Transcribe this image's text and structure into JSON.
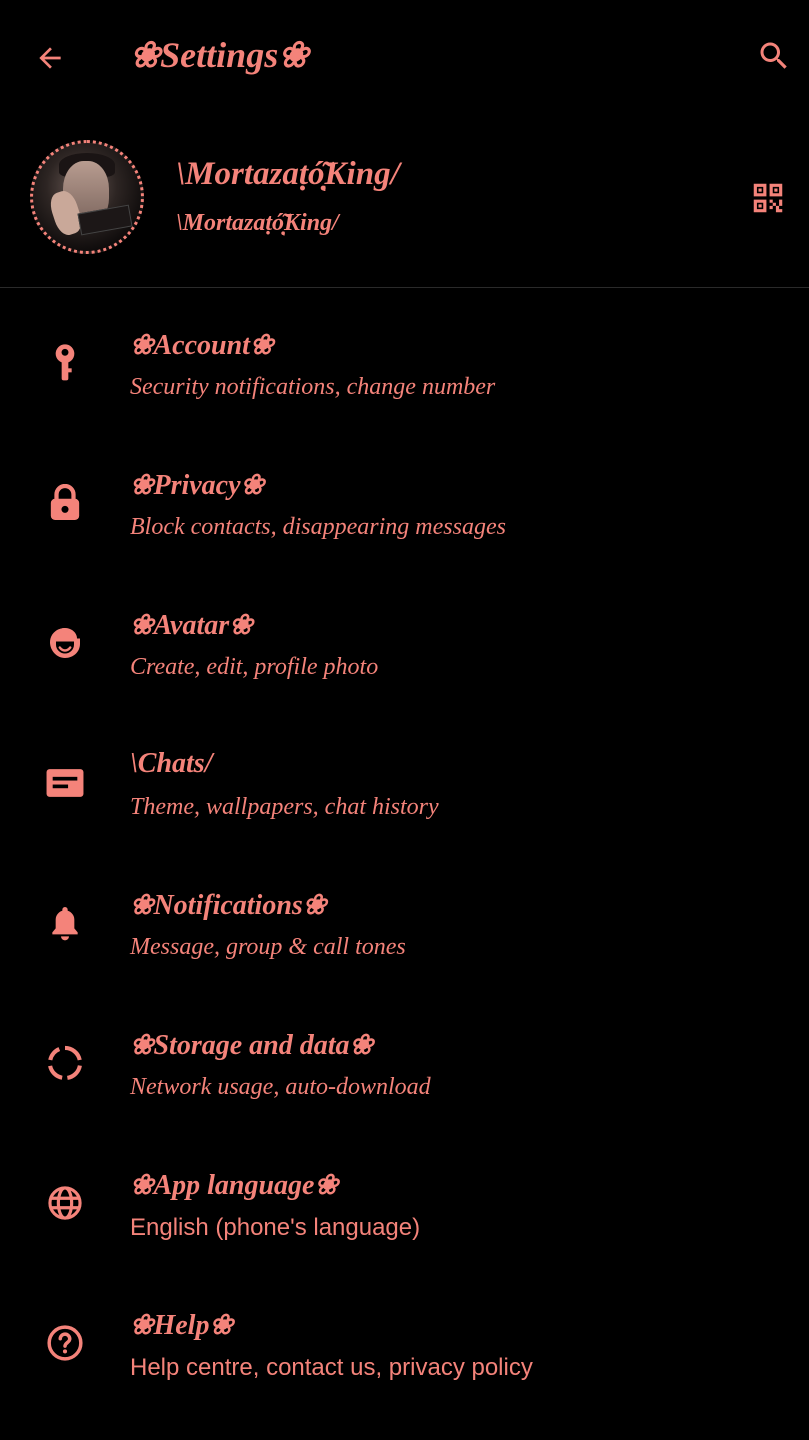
{
  "colors": {
    "background": "#000000",
    "accent": "#f4837a",
    "divider": "#2a2a2a"
  },
  "header": {
    "title": "❀Settings❀",
    "back_icon": "arrow-left-icon",
    "search_icon": "search-icon"
  },
  "profile": {
    "name": "\\Mortazaṭó̩̣͂King/",
    "about": "\\Mortazaṭó̩̣͂King/",
    "qr_icon": "qr-code-icon"
  },
  "menu": {
    "items": [
      {
        "id": "account",
        "icon": "key-icon",
        "title": "❀Account❀",
        "subtitle": "Security notifications, change number",
        "subtitle_style": "italic"
      },
      {
        "id": "privacy",
        "icon": "lock-icon",
        "title": "❀Privacy❀",
        "subtitle": "Block contacts, disappearing messages",
        "subtitle_style": "italic"
      },
      {
        "id": "avatar",
        "icon": "avatar-face-icon",
        "title": "❀Avatar❀",
        "subtitle": "Create, edit, profile photo",
        "subtitle_style": "italic"
      },
      {
        "id": "chats",
        "icon": "chat-icon",
        "title": "\\Chats/",
        "subtitle": "Theme, wallpapers, chat history",
        "subtitle_style": "italic"
      },
      {
        "id": "notifications",
        "icon": "bell-icon",
        "title": "❀Notifications❀",
        "subtitle": "Message, group & call tones",
        "subtitle_style": "italic"
      },
      {
        "id": "storage",
        "icon": "storage-circle-icon",
        "title": "❀Storage and data❀",
        "subtitle": "Network usage, auto-download",
        "subtitle_style": "italic"
      },
      {
        "id": "language",
        "icon": "globe-icon",
        "title": "❀App language❀",
        "subtitle": "English (phone's language)",
        "subtitle_style": "plain"
      },
      {
        "id": "help",
        "icon": "help-circle-icon",
        "title": "❀Help❀",
        "subtitle": "Help centre, contact us, privacy policy",
        "subtitle_style": "plain"
      }
    ]
  }
}
